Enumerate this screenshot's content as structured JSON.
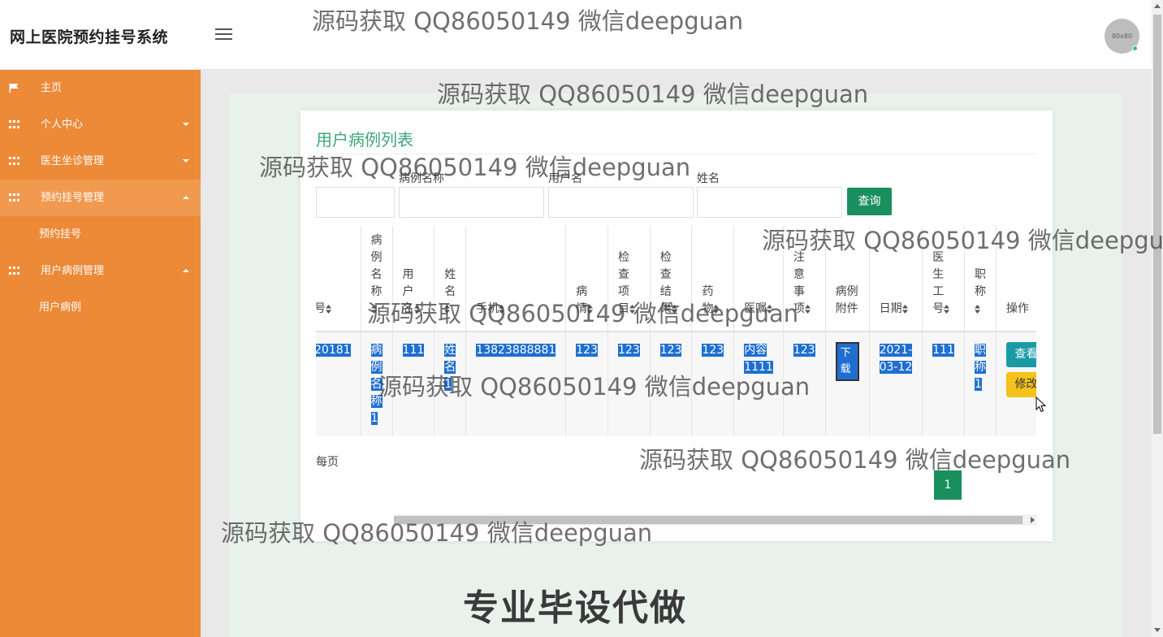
{
  "header": {
    "title": "网上医院预约挂号系统",
    "avatar_text": "80x80"
  },
  "sidebar": {
    "items": [
      {
        "label": "主页",
        "icon": "flag-icon"
      },
      {
        "label": "个人中心",
        "icon": "grid-icon",
        "caret": "down"
      },
      {
        "label": "医生坐诊管理",
        "icon": "grid-icon",
        "caret": "down"
      },
      {
        "label": "预约挂号管理",
        "icon": "grid-icon",
        "caret": "up",
        "open": true,
        "sub": "预约挂号"
      },
      {
        "label": "用户病例管理",
        "icon": "grid-icon",
        "caret": "up",
        "sub": "用户病例"
      }
    ]
  },
  "main": {
    "title": "用户病例列表",
    "search": {
      "fields": [
        {
          "label": "病例名称",
          "value": ""
        },
        {
          "label": "用户名",
          "value": ""
        },
        {
          "label": "姓名",
          "value": ""
        }
      ],
      "button": "查询"
    },
    "table": {
      "headers": [
        "号",
        "病例名称",
        "用户名",
        "姓名",
        "手机",
        "病情",
        "检查项目",
        "检查结果",
        "药物",
        "医嘱",
        "注意事项",
        "病例附件",
        "日期",
        "医生工号",
        "职称",
        "操作"
      ],
      "row": {
        "id": "20181",
        "case_name": "病例名称1",
        "username": "111",
        "name": "姓名1",
        "phone": "13823888881",
        "condition": "123",
        "exam_items": "123",
        "exam_result": "123",
        "drug": "123",
        "advice": "内容1111",
        "notes": "123",
        "attachment": "下载",
        "date": "2021-03-12",
        "doctor_id": "111",
        "title": "职称1",
        "view_btn": "查看",
        "edit_btn": "修改"
      }
    },
    "per_page": "每页",
    "page": "1"
  },
  "watermark": "源码获取 QQ86050149 微信deepguan",
  "banner": "专业毕设代做",
  "colors": {
    "sidebar": "#ed8a38",
    "accent": "#1a8f5e",
    "title": "#3ea67a",
    "highlight": "#1f6fd1"
  }
}
